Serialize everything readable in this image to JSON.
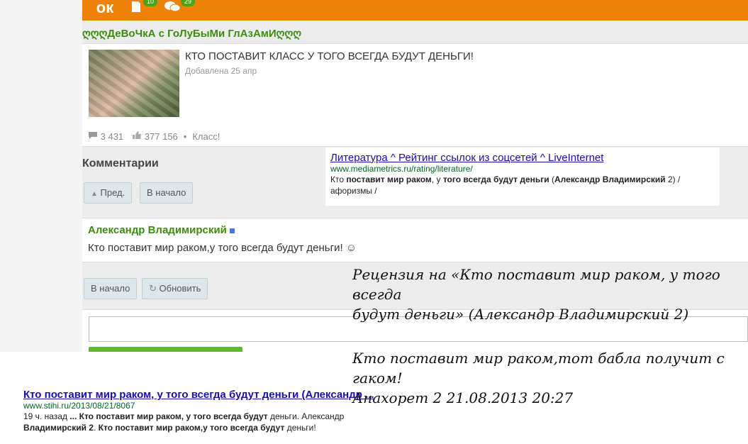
{
  "topbar": {
    "logo": "ок",
    "notifications_count": "10",
    "messages_count": "29"
  },
  "post": {
    "author": "ღღღДеВоЧкА с ГоЛуБыМи ГлАзАмИღღღ",
    "title": "КТО ПОСТАВИТ КЛАСС У ТОГО ВСЕГДА БУДУТ ДЕНЬГИ!",
    "date": "Добавлена 25 апр",
    "comments_count": "3 431",
    "likes_count": "377 156",
    "class_label": "Класс!"
  },
  "comments": {
    "title": "Комментарии",
    "prev_button": "Пред.",
    "start_button": "В начало",
    "author": "Александр Владимирский",
    "text": "Кто поставит мир раком,у того всегда будут деньги! ☺",
    "start_button_2": "В начало",
    "refresh_button": "Обновить"
  },
  "search_top": {
    "title": "Литература ^ Рейтинг ссылок из соцсетей ^ LiveInternet",
    "url": "www.mediametrics.ru/rating/literature/",
    "snippet_1": "Кто ",
    "snippet_2": "поставит мир раком",
    "snippet_3": ", у ",
    "snippet_4": "того всегда будут деньги",
    "snippet_5": " (",
    "snippet_6": "Александр Владимирский",
    "snippet_7": " 2) /",
    "snippet_8": "афоризмы /"
  },
  "search_bottom": {
    "title": "Кто поставит мир раком, у того всегда будут деньги (Александр ...",
    "url": "www.stihi.ru/2013/08/21/8067",
    "snippet_1": "19 ч. назад ",
    "snippet_2": "... Кто поставит мир раком, у того всегда будут",
    "snippet_3": " деньги. Александр",
    "snippet_4": "Владимирский 2",
    "snippet_5": ". ",
    "snippet_6": "Кто поставит мир раком,у того всегда будут",
    "snippet_7": " деньги!"
  },
  "handwritten": {
    "review_line_1": "Рецензия на «Кто поставит мир раком, у того всегда",
    "review_line_2": "будут деньги» (Александр Владимирский 2)",
    "reply_line_1": "Кто поставит мир раком,тот бабла получит с гаком!",
    "reply_line_2": "Анахорет 2    21.08.2013 20:27"
  }
}
